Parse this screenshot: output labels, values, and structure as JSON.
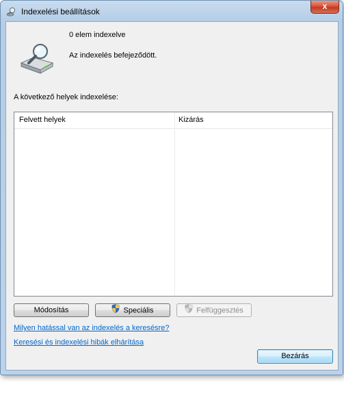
{
  "window": {
    "title": "Indexelési beállítások",
    "close_glyph": "x"
  },
  "status": {
    "count_text": "0 elem indexelve",
    "message": "Az indexelés befejeződött."
  },
  "locations": {
    "label": "A következő helyek indexelése:",
    "columns": [
      "Felvett helyek",
      "Kizárás"
    ],
    "rows": []
  },
  "buttons": {
    "modify": "Módosítás",
    "advanced": "Speciális",
    "pause": "Felfüggesztés",
    "close": "Bezárás"
  },
  "links": {
    "effect": "Milyen hatással van az indexelés a keresésre?",
    "troubleshoot": "Keresési és indexelési hibák elhárítása"
  },
  "icons": {
    "title": "magnifier-drive-icon",
    "status": "indexing-drive-icon",
    "advanced": "uac-shield-icon",
    "pause": "uac-shield-icon"
  }
}
